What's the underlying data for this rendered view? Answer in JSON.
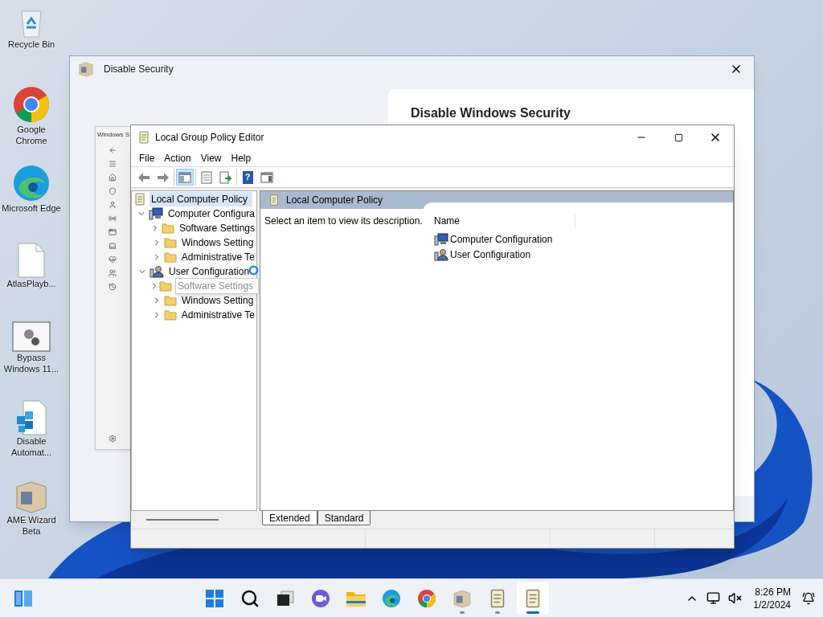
{
  "desktop_icons": [
    {
      "label": "Recycle Bin",
      "kind": "recycle"
    },
    {
      "label": "Google Chrome",
      "kind": "chrome"
    },
    {
      "label": "Microsoft Edge",
      "kind": "edge"
    },
    {
      "label": "AtlasPlayb...",
      "kind": "file"
    },
    {
      "label": "Bypass Windows 11...",
      "kind": "gears"
    },
    {
      "label": "Disable Automat...",
      "kind": "cubes"
    },
    {
      "label": "AME Wizard Beta",
      "kind": "box"
    }
  ],
  "background_window": {
    "title": "Disable Security",
    "heading": "Disable Windows Security"
  },
  "side_window": {
    "title": "Windows S"
  },
  "window": {
    "title": "Local Group Policy Editor",
    "menu": [
      "File",
      "Action",
      "View",
      "Help"
    ],
    "toolbar": [
      [
        {
          "kind": "back",
          "pressed": false
        },
        {
          "kind": "forward",
          "pressed": false
        }
      ],
      [
        {
          "kind": "tree",
          "pressed": true
        }
      ],
      [
        {
          "kind": "properties",
          "pressed": false
        },
        {
          "kind": "export",
          "pressed": false
        }
      ],
      [
        {
          "kind": "help",
          "pressed": false,
          "label": "?"
        },
        {
          "kind": "panel",
          "pressed": false
        }
      ]
    ],
    "tree": {
      "label": "Local Computer Policy",
      "kind": "policy",
      "selected": true,
      "children": [
        {
          "label": "Computer Configura",
          "kind": "computer",
          "expanded": true,
          "selected": false,
          "children": [
            {
              "label": "Software Settings",
              "kind": "folder",
              "expanded": false,
              "selected": false,
              "tooltip": false
            },
            {
              "label": "Windows Setting",
              "kind": "folder",
              "expanded": false,
              "selected": false,
              "tooltip": false
            },
            {
              "label": "Administrative Te",
              "kind": "folder",
              "expanded": false,
              "selected": false,
              "tooltip": false
            }
          ]
        },
        {
          "label": "User Configuration",
          "kind": "user",
          "expanded": true,
          "selected": false,
          "children": [
            {
              "label": "Software Settings",
              "kind": "folder",
              "expanded": false,
              "selected": false,
              "tooltip": true
            },
            {
              "label": "Windows Setting",
              "kind": "folder",
              "expanded": false,
              "selected": false,
              "tooltip": false
            },
            {
              "label": "Administrative Te",
              "kind": "folder",
              "expanded": false,
              "selected": false,
              "tooltip": false
            }
          ]
        }
      ]
    },
    "pane_title": "Local Computer Policy",
    "description": "Select an item to view its description.",
    "column": "Name",
    "items": [
      {
        "label": "Computer Configuration",
        "kind": "computer"
      },
      {
        "label": "User Configuration",
        "kind": "user"
      }
    ],
    "tabs": [
      {
        "label": "Extended",
        "selected": true
      },
      {
        "label": "Standard",
        "selected": false
      }
    ]
  },
  "taskbar": {
    "apps": [
      {
        "kind": "start",
        "running": false,
        "active": false
      },
      {
        "kind": "search",
        "running": false,
        "active": false
      },
      {
        "kind": "taskview",
        "running": false,
        "active": false
      },
      {
        "kind": "chat",
        "running": false,
        "active": false
      },
      {
        "kind": "explorer",
        "running": false,
        "active": false
      },
      {
        "kind": "edge",
        "running": false,
        "active": false
      },
      {
        "kind": "chrome",
        "running": false,
        "active": false
      },
      {
        "kind": "box",
        "running": true,
        "active": false
      },
      {
        "kind": "scroll",
        "running": true,
        "active": false
      },
      {
        "kind": "scroll",
        "running": true,
        "active": true
      }
    ],
    "time": "8:26 PM",
    "date": "1/2/2024"
  }
}
